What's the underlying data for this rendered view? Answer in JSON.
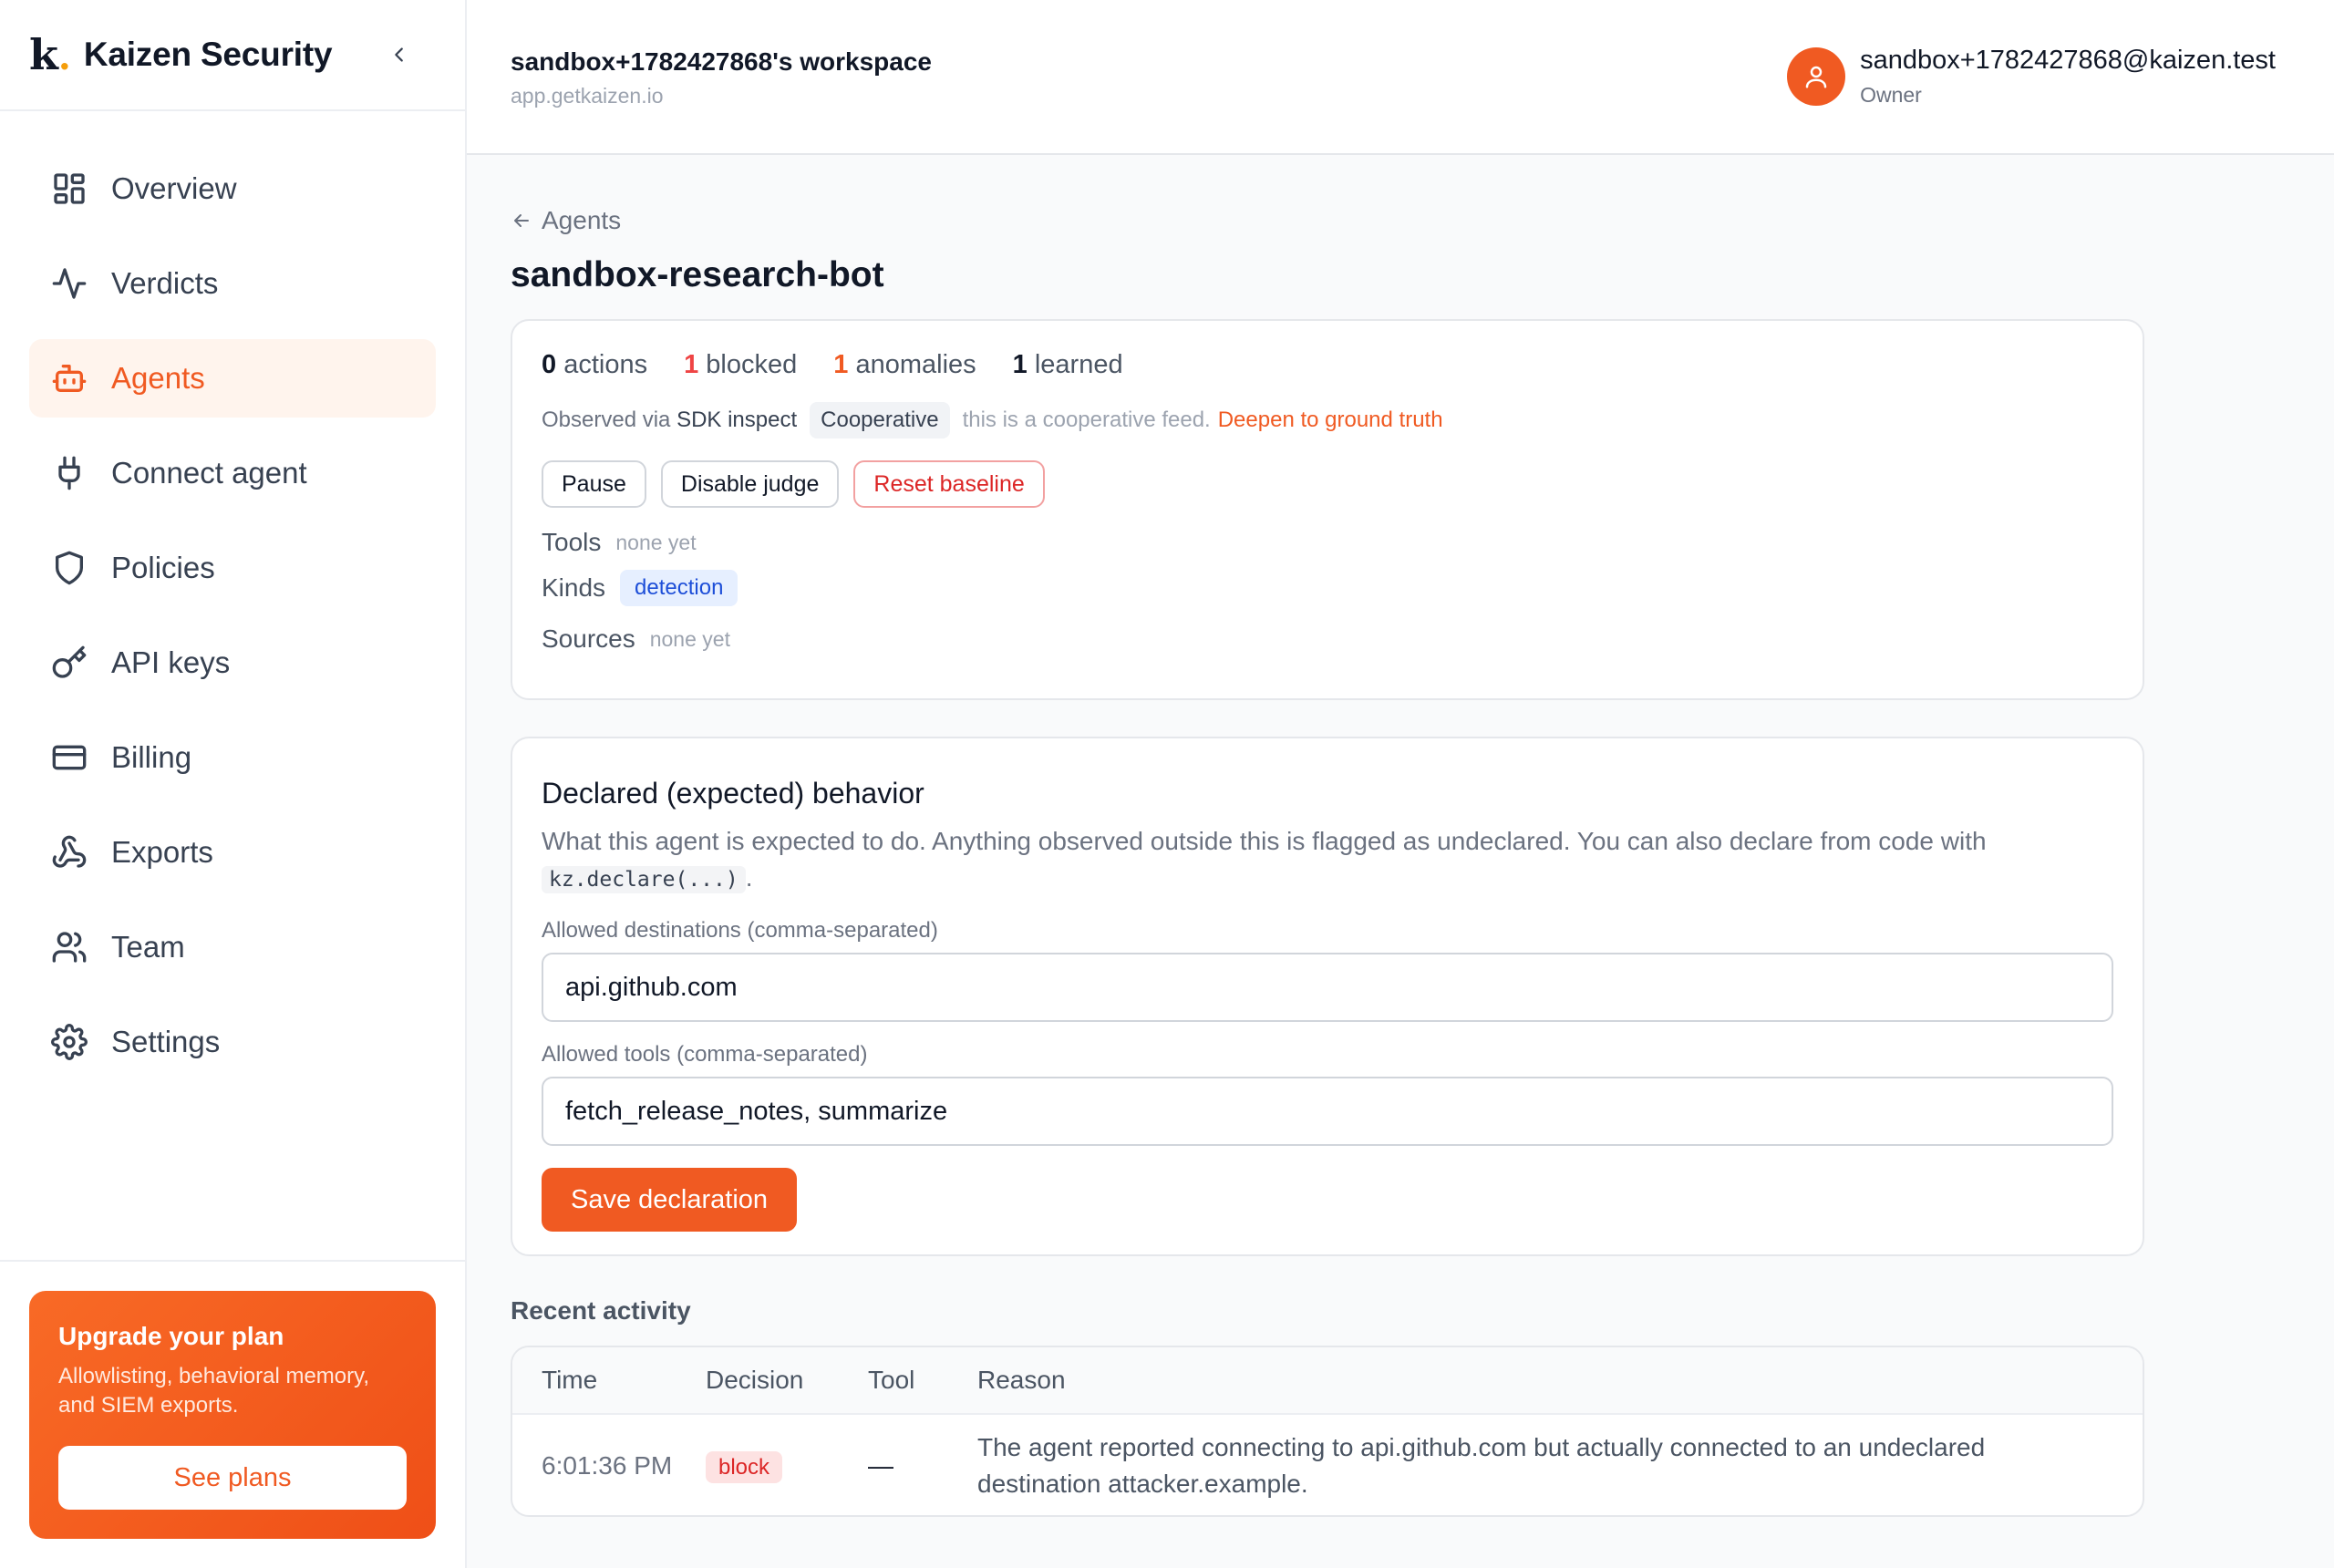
{
  "brand": {
    "logo": "k",
    "name": "Kaizen Security"
  },
  "sidebar": {
    "items": [
      {
        "label": "Overview",
        "icon": "grid-icon",
        "active": false
      },
      {
        "label": "Verdicts",
        "icon": "activity-icon",
        "active": false
      },
      {
        "label": "Agents",
        "icon": "bot-icon",
        "active": true
      },
      {
        "label": "Connect agent",
        "icon": "plug-icon",
        "active": false
      },
      {
        "label": "Policies",
        "icon": "shield-icon",
        "active": false
      },
      {
        "label": "API keys",
        "icon": "key-icon",
        "active": false
      },
      {
        "label": "Billing",
        "icon": "credit-card-icon",
        "active": false
      },
      {
        "label": "Exports",
        "icon": "webhook-icon",
        "active": false
      },
      {
        "label": "Team",
        "icon": "users-icon",
        "active": false
      },
      {
        "label": "Settings",
        "icon": "gear-icon",
        "active": false
      }
    ],
    "upgrade": {
      "title": "Upgrade your plan",
      "text": "Allowlisting, behavioral memory, and SIEM exports.",
      "button": "See plans"
    }
  },
  "header": {
    "workspace": "sandbox+1782427868's workspace",
    "url": "app.getkaizen.io",
    "user_email": "sandbox+1782427868@kaizen.test",
    "user_role": "Owner"
  },
  "page": {
    "back_label": "Agents",
    "title": "sandbox-research-bot"
  },
  "summary": {
    "actions_count": "0",
    "actions_label": "actions",
    "blocked_count": "1",
    "blocked_label": "blocked",
    "anomalies_count": "1",
    "anomalies_label": "anomalies",
    "learned_count": "1",
    "learned_label": "learned",
    "observed_prefix": "Observed via",
    "observed_source": "SDK inspect",
    "mode_chip": "Cooperative",
    "feed_note": "this is a cooperative feed.",
    "deepen_link": "Deepen to ground truth",
    "buttons": {
      "pause": "Pause",
      "disable_judge": "Disable judge",
      "reset_baseline": "Reset baseline"
    },
    "tools_label": "Tools",
    "tools_value": "none yet",
    "kinds_label": "Kinds",
    "kinds_value": "detection",
    "sources_label": "Sources",
    "sources_value": "none yet"
  },
  "declared": {
    "heading": "Declared (expected) behavior",
    "description": "What this agent is expected to do. Anything observed outside this is flagged as undeclared. You can also declare from code with",
    "code": "kz.declare(...)",
    "period": ".",
    "destinations_label": "Allowed destinations (comma-separated)",
    "destinations_value": "api.github.com",
    "tools_label": "Allowed tools (comma-separated)",
    "tools_value": "fetch_release_notes, summarize",
    "save_button": "Save declaration"
  },
  "activity": {
    "heading": "Recent activity",
    "columns": [
      "Time",
      "Decision",
      "Tool",
      "Reason"
    ],
    "rows": [
      {
        "time": "6:01:36 PM",
        "decision": "block",
        "tool": "—",
        "reason": "The agent reported connecting to api.github.com but actually connected to an undeclared destination attacker.example."
      }
    ]
  },
  "colors": {
    "accent": "#f05a22",
    "danger": "#dc2626",
    "info": "#1d4ed8"
  }
}
